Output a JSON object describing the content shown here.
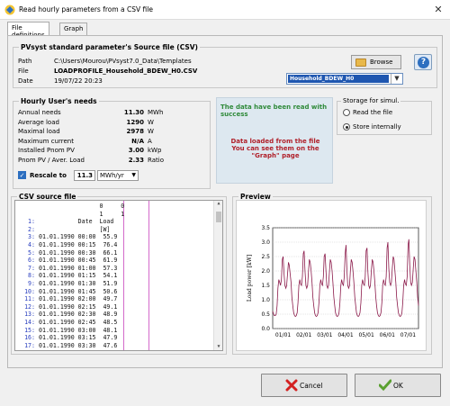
{
  "window": {
    "title": "Read hourly parameters from a CSV file"
  },
  "tabs": [
    {
      "label": "File definitions"
    },
    {
      "label": "Graph"
    }
  ],
  "source": {
    "legend": "PVsyst standard parameter's Source file (CSV)",
    "path_label": "Path",
    "path_value": "C:\\Users\\Mourou\\PVsyst7.0_Data\\Templates",
    "path_box": "",
    "file_label": "File",
    "file_value": "LOADPROFILE_Household_BDEW_H0.CSV",
    "date_label": "Date",
    "date_value": "19/07/22 20:23",
    "browse_label": "Browse",
    "select_value": "Household_BDEW_H0"
  },
  "needs": {
    "legend": "Hourly User's needs",
    "rows": [
      {
        "label": "Annual needs",
        "value": "11.30",
        "unit": "MWh"
      },
      {
        "label": "Average load",
        "value": "1290",
        "unit": "W"
      },
      {
        "label": "Maximal load",
        "value": "2978",
        "unit": "W"
      },
      {
        "label": "Maximum current",
        "value": "N/A",
        "unit": "A"
      },
      {
        "label": "Installed Pnom PV",
        "value": "3.00",
        "unit": "kWp"
      },
      {
        "label": "Pnom PV / Aver. Load",
        "value": "2.33",
        "unit": "Ratio"
      }
    ],
    "rescale_label": "Rescale to",
    "rescale_value": "11.3",
    "rescale_unit": "MWh/yr"
  },
  "info": {
    "green": "The data have been read with success",
    "red": "Data loaded from the file\nYou can see them on the \"Graph\" page"
  },
  "storage": {
    "legend": "Storage for simul.",
    "option1": "Read the file",
    "option2": "Store internally",
    "selected": "Store internally"
  },
  "csv": {
    "legend": "CSV source file",
    "lines": [
      {
        "n": "",
        "t": "                 0     0"
      },
      {
        "n": "",
        "t": "                 1     1"
      },
      {
        "n": "1:",
        "t": "           Date  Load"
      },
      {
        "n": "2:",
        "t": "                 [W]"
      },
      {
        "n": "3:",
        "t": "01.01.1990 00:00  55.9"
      },
      {
        "n": "4:",
        "t": "01.01.1990 00:15  76.4"
      },
      {
        "n": "5:",
        "t": "01.01.1990 00:30  66.1"
      },
      {
        "n": "6:",
        "t": "01.01.1990 00:45  61.9"
      },
      {
        "n": "7:",
        "t": "01.01.1990 01:00  57.3"
      },
      {
        "n": "8:",
        "t": "01.01.1990 01:15  54.1"
      },
      {
        "n": "9:",
        "t": "01.01.1990 01:30  51.9"
      },
      {
        "n": "10:",
        "t": "01.01.1990 01:45  50.6"
      },
      {
        "n": "11:",
        "t": "01.01.1990 02:00  49.7"
      },
      {
        "n": "12:",
        "t": "01.01.1990 02:15  49.1"
      },
      {
        "n": "13:",
        "t": "01.01.1990 02:30  48.9"
      },
      {
        "n": "14:",
        "t": "01.01.1990 02:45  48.5"
      },
      {
        "n": "15:",
        "t": "01.01.1990 03:00  48.1"
      },
      {
        "n": "16:",
        "t": "01.01.1990 03:15  47.9"
      },
      {
        "n": "17:",
        "t": "01.01.1990 03:30  47.6"
      }
    ]
  },
  "preview": {
    "legend": "Preview",
    "accent": "#8b1a4a",
    "chart_data": {
      "type": "line",
      "ylabel": "Load power [kW]",
      "ylim": [
        0,
        3.5
      ],
      "yticks": [
        "0.0",
        "0.5",
        "1.0",
        "1.5",
        "2.0",
        "2.5",
        "3.0",
        "3.5"
      ],
      "xticks": [
        "01/01",
        "02/01",
        "03/01",
        "04/01",
        "05/01",
        "06/01",
        "07/01"
      ],
      "series": [
        {
          "values": [
            0.6,
            0.5,
            0.45,
            0.45,
            0.5,
            0.8,
            1.4,
            1.7,
            1.6,
            1.5,
            1.7,
            2.4,
            2.5,
            1.9,
            1.5,
            1.4,
            1.5,
            1.9,
            2.3,
            2.2,
            1.9,
            1.6,
            1.1,
            0.8,
            0.55,
            0.45,
            0.42,
            0.45,
            0.55,
            0.9,
            1.5,
            1.7,
            1.55,
            1.5,
            1.8,
            2.6,
            2.7,
            2.0,
            1.5,
            1.4,
            1.5,
            2.0,
            2.4,
            2.3,
            2.0,
            1.6,
            1.1,
            0.8,
            0.55,
            0.45,
            0.42,
            0.45,
            0.55,
            0.9,
            1.5,
            1.7,
            1.55,
            1.5,
            1.8,
            2.5,
            2.6,
            2.0,
            1.5,
            1.4,
            1.5,
            2.0,
            2.4,
            2.3,
            2.0,
            1.6,
            1.1,
            0.8,
            0.55,
            0.45,
            0.42,
            0.45,
            0.55,
            0.9,
            1.5,
            1.7,
            1.55,
            1.5,
            1.8,
            2.6,
            2.9,
            2.0,
            1.5,
            1.4,
            1.5,
            2.0,
            2.4,
            2.3,
            2.0,
            1.6,
            1.1,
            0.8,
            0.55,
            0.45,
            0.42,
            0.45,
            0.55,
            0.9,
            1.5,
            1.7,
            1.55,
            1.5,
            1.8,
            2.7,
            2.8,
            2.0,
            1.5,
            1.4,
            1.5,
            2.0,
            2.4,
            2.3,
            2.0,
            1.6,
            1.1,
            0.8,
            0.55,
            0.45,
            0.42,
            0.45,
            0.55,
            0.9,
            1.5,
            1.7,
            1.55,
            1.5,
            1.8,
            2.8,
            3.0,
            2.1,
            1.6,
            1.5,
            1.6,
            2.1,
            2.5,
            2.4,
            2.0,
            1.6,
            1.1,
            0.8,
            0.55,
            0.45,
            0.42,
            0.45,
            0.55,
            0.9,
            1.5,
            1.7,
            1.55,
            1.5,
            1.8,
            2.9,
            3.1,
            2.2,
            1.6,
            1.5,
            1.6,
            2.1,
            2.5,
            2.4,
            2.0,
            1.6,
            1.1,
            0.8
          ]
        }
      ]
    }
  },
  "buttons": {
    "cancel": "Cancel",
    "ok": "OK"
  }
}
